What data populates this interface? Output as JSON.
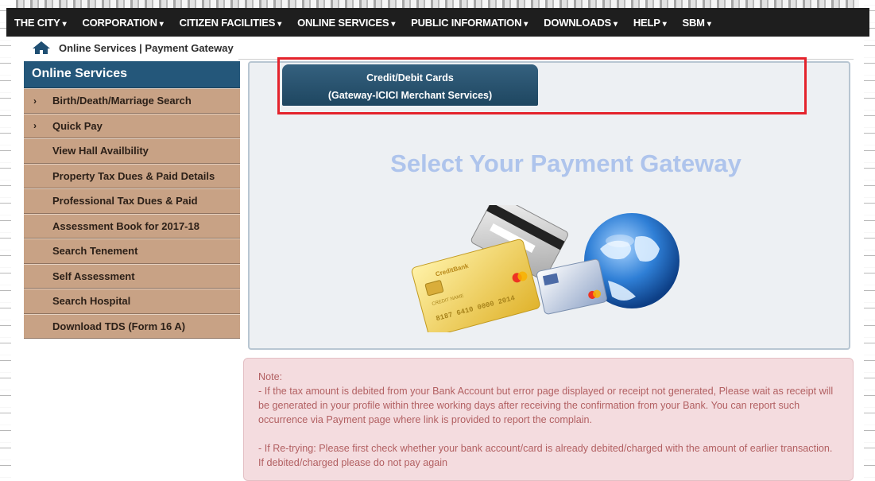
{
  "nav": {
    "items": [
      {
        "label": "THE CITY"
      },
      {
        "label": "CORPORATION"
      },
      {
        "label": "CITIZEN FACILITIES"
      },
      {
        "label": "ONLINE SERVICES"
      },
      {
        "label": "PUBLIC INFORMATION"
      },
      {
        "label": "DOWNLOADS"
      },
      {
        "label": "HELP"
      },
      {
        "label": "SBM"
      }
    ]
  },
  "breadcrumb": {
    "text": "Online Services | Payment Gateway",
    "icon": "home-icon"
  },
  "sidebar": {
    "title": "Online Services",
    "items": [
      {
        "label": "Birth/Death/Marriage Search",
        "expandable": true
      },
      {
        "label": "Quick Pay",
        "expandable": true
      },
      {
        "label": "View Hall Availbility"
      },
      {
        "label": "Property Tax Dues & Paid Details"
      },
      {
        "label": "Professional Tax Dues & Paid"
      },
      {
        "label": "Assessment Book for 2017-18"
      },
      {
        "label": "Search Tenement"
      },
      {
        "label": "Self Assessment"
      },
      {
        "label": "Search Hospital"
      },
      {
        "label": "Download TDS (Form 16 A)"
      }
    ]
  },
  "main": {
    "tab_line1": "Credit/Debit Cards",
    "tab_line2": "(Gateway-ICICI Merchant Services)",
    "headline": "Select Your Payment Gateway",
    "card_text": {
      "bank": "CreditBank",
      "number": "8187 6410 0000 2014",
      "name": "CREDIT NAME"
    }
  },
  "note": {
    "heading": "Note:",
    "para1": "- If the tax amount is debited from your Bank Account but error page displayed or receipt not generated, Please wait as receipt will be generated in your profile within three working days after receiving the confirmation from your Bank. You can report such occurrence via Payment page where link is provided to report the complain.",
    "para2": "- If Re-trying: Please first check whether your bank account/card is already debited/charged with the amount of earlier transaction. If debited/charged please do not pay again"
  },
  "colors": {
    "nav_bg": "#1e1e1e",
    "sidebar_header": "#24577a",
    "sidebar_item": "#c8a285",
    "highlight": "#e4232c",
    "headline": "#aec4ec",
    "note_bg": "#f4dcdf"
  }
}
